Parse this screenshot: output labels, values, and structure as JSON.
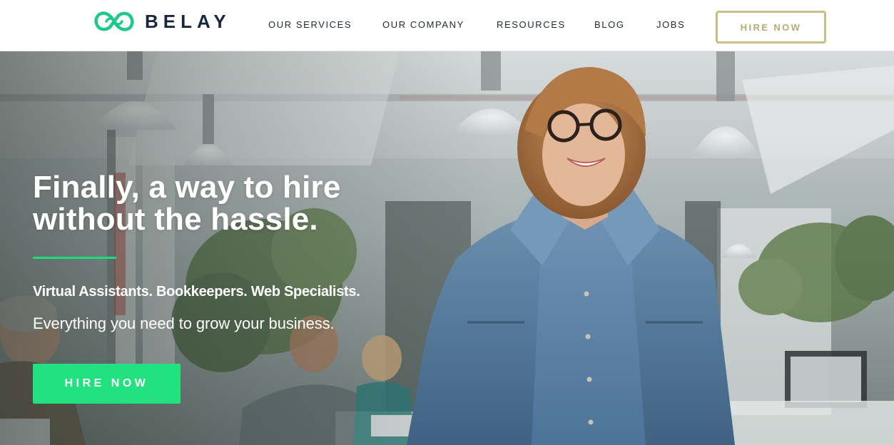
{
  "brand": {
    "name": "BELAY",
    "logo_icon": "infinity-loop-icon",
    "logo_color": "#1fc98a",
    "wordmark_color": "#17283d"
  },
  "nav": {
    "items": [
      {
        "label": "OUR SERVICES"
      },
      {
        "label": "OUR COMPANY"
      },
      {
        "label": "RESOURCES"
      },
      {
        "label": "BLOG"
      },
      {
        "label": "JOBS"
      }
    ],
    "cta_label": "HIRE NOW",
    "cta_color": "#cbbd86"
  },
  "hero": {
    "headline_line1": "Finally, a way to hire",
    "headline_line2": "without the hassle.",
    "subheadline": "Virtual Assistants. Bookkeepers. Web Specialists.",
    "tagline": "Everything you need to grow your business.",
    "cta_label": "HIRE NOW",
    "accent_color": "#22e27f",
    "background": "office-photo-smiling-woman-denim-jacket"
  }
}
